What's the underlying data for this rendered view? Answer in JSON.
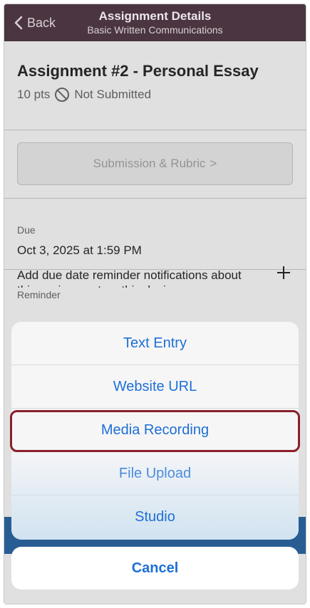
{
  "nav": {
    "back_label": "Back",
    "title": "Assignment Details",
    "subtitle": "Basic Written Communications"
  },
  "assignment": {
    "title": "Assignment #2 - Personal Essay",
    "points": "10 pts",
    "status": "Not Submitted"
  },
  "submission_button": {
    "label": "Submission & Rubric",
    "chevron": ">"
  },
  "due": {
    "label": "Due",
    "value": "Oct 3, 2025 at 1:59 PM"
  },
  "reminder": {
    "label": "Reminder",
    "text": "Add due date reminder notifications about this assignment on this device."
  },
  "action_sheet": {
    "options": [
      "Text Entry",
      "Website URL",
      "Media Recording",
      "File Upload",
      "Studio"
    ],
    "cancel_label": "Cancel",
    "highlighted": "Media Recording"
  },
  "colors": {
    "nav_bg": "#4a3540",
    "action_blue": "#1d6fd6",
    "highlight_border": "#8a1f2a",
    "band_blue": "#2d6aa7"
  }
}
